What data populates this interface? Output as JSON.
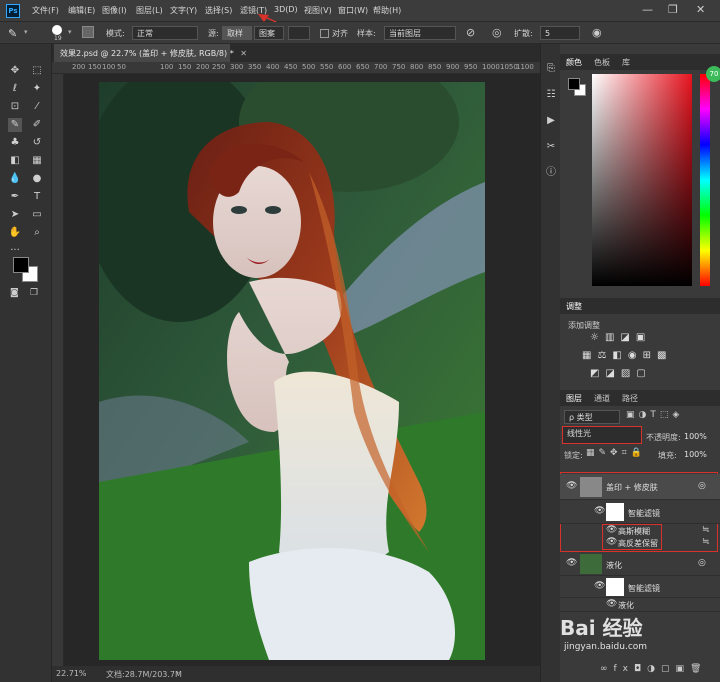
{
  "app": {
    "icon_text": "Ps"
  },
  "menu": [
    "文件(F)",
    "编辑(E)",
    "图像(I)",
    "图层(L)",
    "文字(Y)",
    "选择(S)",
    "滤镜(T)",
    "3D(D)",
    "视图(V)",
    "窗口(W)",
    "帮助(H)"
  ],
  "window_controls": {
    "minimize": "—",
    "restore": "❐",
    "close": "✕"
  },
  "options_bar": {
    "brush_size": "19",
    "mode_label": "模式:",
    "mode_value": "正常",
    "source_label": "源:",
    "source_sample": "取样",
    "source_pattern": "图案",
    "align_label": "对齐",
    "sample_label": "样本:",
    "sample_value": "当前图层",
    "spread_label": "扩散:",
    "spread_value": "5"
  },
  "document": {
    "tab_title": "效果2.psd @ 22.7% (盖印 + 修皮肤, RGB/8) *",
    "ruler_ticks": [
      "200",
      "150",
      "100",
      "50",
      "0",
      "50",
      "100",
      "150",
      "200",
      "250",
      "300",
      "350",
      "400",
      "450",
      "500",
      "550",
      "600",
      "650",
      "700",
      "750",
      "800",
      "850",
      "900",
      "950",
      "1000",
      "1050",
      "1100"
    ],
    "zoom": "22.71%",
    "doc_size": "文档:28.7M/203.7M"
  },
  "color_panel": {
    "tabs": [
      "颜色",
      "色板",
      "库"
    ],
    "badge": "70"
  },
  "adjustments_panel": {
    "tab": "调整",
    "title": "添加调整"
  },
  "layers_panel": {
    "tabs": [
      "图层",
      "通道",
      "路径"
    ],
    "filter_type": "ρ 类型",
    "blend_mode": "线性光",
    "opacity_label": "不透明度:",
    "opacity_value": "100%",
    "lock_label": "锁定:",
    "fill_label": "填充:",
    "fill_value": "100%",
    "layers": [
      {
        "name": "盖印 + 修皮肤",
        "type": "smart-object"
      },
      {
        "name": "智能滤镜",
        "type": "smart-filter-mask"
      },
      {
        "name": "高斯模糊",
        "type": "filter"
      },
      {
        "name": "高反差保留",
        "type": "filter"
      },
      {
        "name": "液化",
        "type": "smart-object"
      },
      {
        "name": "智能滤镜",
        "type": "smart-filter-mask"
      },
      {
        "name": "液化",
        "type": "filter"
      }
    ]
  },
  "watermark": {
    "text": "Bai 经验",
    "url": "jingyan.baidu.com"
  },
  "colors": {
    "accent_red": "#d8322a",
    "ps_blue": "#31a8ff",
    "foreground": "#000000",
    "background": "#ffffff"
  }
}
